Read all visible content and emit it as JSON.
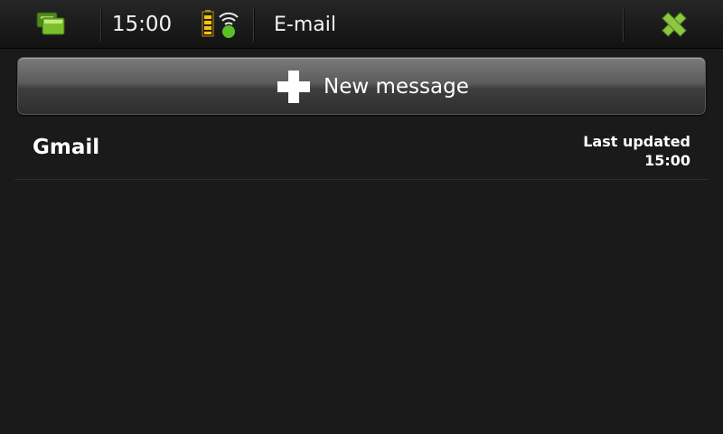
{
  "status_bar": {
    "time": "15:00",
    "app_title": "E-mail",
    "icons": {
      "task_switcher": "task-switcher-icon",
      "battery": "battery-icon",
      "connectivity": "wifi-icon",
      "close": "close-icon"
    }
  },
  "toolbar": {
    "new_message_label": "New message",
    "new_message_icon": "plus-icon"
  },
  "accounts": [
    {
      "name": "Gmail",
      "last_updated_label": "Last updated",
      "last_updated_time": "15:00"
    }
  ],
  "colors": {
    "accent_green": "#8dc63f",
    "background": "#1a1a1a",
    "text": "#ffffff"
  }
}
